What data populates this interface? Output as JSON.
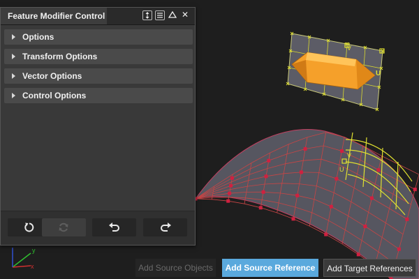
{
  "panel": {
    "title": "Feature Modifier Control",
    "header_icons": [
      "expand-collapse-icon",
      "list-icon",
      "triangle-up-icon",
      "close-icon"
    ],
    "close_glyph": "✕",
    "sections": [
      {
        "label": "Options"
      },
      {
        "label": "Transform Options"
      },
      {
        "label": "Vector Options"
      },
      {
        "label": "Control Options"
      }
    ],
    "footer_buttons": [
      {
        "name": "reset-button",
        "icon": "reset-icon",
        "enabled": true
      },
      {
        "name": "refresh-button",
        "icon": "refresh-icon",
        "enabled": false
      },
      {
        "name": "undo-button",
        "icon": "undo-arrow-icon",
        "enabled": true
      },
      {
        "name": "redo-button",
        "icon": "redo-arrow-icon",
        "enabled": true
      }
    ]
  },
  "viewport": {
    "gizmo_labels": {
      "v": "V",
      "u": "U"
    },
    "axis_labels": {
      "y": "y",
      "x": "x"
    },
    "colors": {
      "background": "#1e1e1e",
      "shape_fill": "#f5a02a",
      "lattice_line": "#e0e030",
      "surface_fill": "#5a5a66",
      "surface_grid": "#d04040",
      "axis_y": "#30c030",
      "axis_x": "#d03030",
      "axis_z": "#3050d0"
    }
  },
  "bottom_buttons": {
    "add_source_objects": "Add Source Objects",
    "add_source_reference": "Add Source Reference",
    "add_target_references": "Add Target References"
  },
  "accent_color": "#5aa9dd"
}
